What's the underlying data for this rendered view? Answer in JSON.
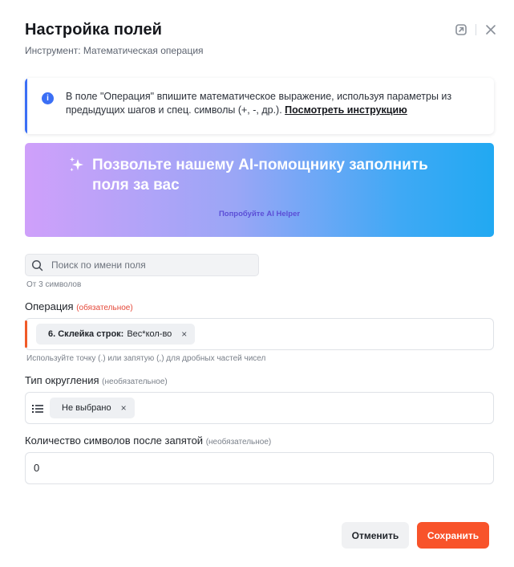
{
  "header": {
    "title": "Настройка полей",
    "subtitle": "Инструмент: Математическая операция"
  },
  "info": {
    "text": "В поле \"Операция\" впишите математическое выражение, используя параметры из предыдущих шагов и спец. символы (+, -, др.). ",
    "link": "Посмотреть инструкцию"
  },
  "ai_banner": {
    "headline": "Позвольте нашему AI-помощнику заполнить поля за вас",
    "cta": "Попробуйте AI Helper"
  },
  "search": {
    "placeholder": "Поиск по имени поля",
    "hint": "От 3 символов"
  },
  "fields": {
    "operation": {
      "label": "Операция",
      "badge": "(обязательное)",
      "tag_bold": "6. Склейка строк:",
      "tag_value": "Вес*кол-во",
      "hint": "Используйте точку (.) или запятую (,) для дробных частей чисел"
    },
    "rounding": {
      "label": "Тип округления",
      "badge": "(необязательное)",
      "tag_value": "Не выбрано"
    },
    "decimals": {
      "label": "Количество символов после запятой",
      "badge": "(необязательное)",
      "value": "0"
    }
  },
  "footer": {
    "cancel": "Отменить",
    "save": "Сохранить"
  },
  "colors": {
    "accent": "#f8532a",
    "info": "#3b6ff5",
    "required": "#e5493a"
  }
}
